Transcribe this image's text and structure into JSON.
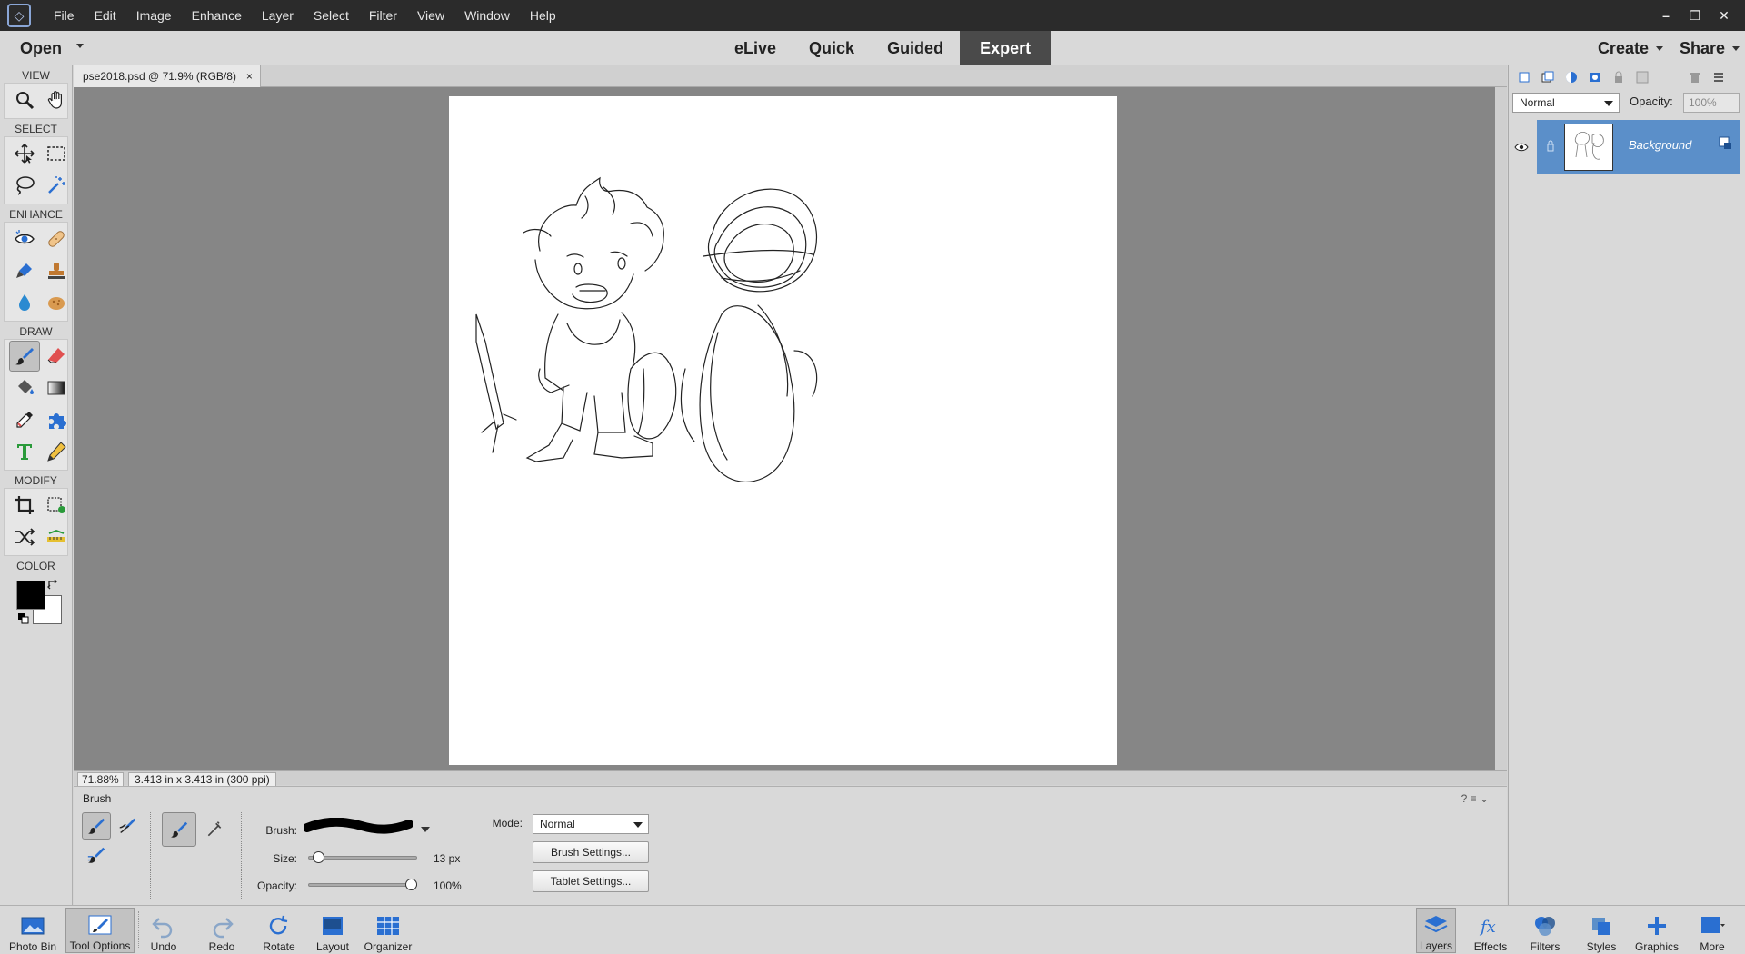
{
  "menubar": {
    "items": [
      "File",
      "Edit",
      "Image",
      "Enhance",
      "Layer",
      "Select",
      "Filter",
      "View",
      "Window",
      "Help"
    ]
  },
  "modebar": {
    "open_label": "Open",
    "tabs": [
      "eLive",
      "Quick",
      "Guided",
      "Expert"
    ],
    "active_tab": "Expert",
    "create_label": "Create",
    "share_label": "Share"
  },
  "toolbox": {
    "sections": {
      "view": "VIEW",
      "select": "SELECT",
      "enhance": "ENHANCE",
      "draw": "DRAW",
      "modify": "MODIFY",
      "color": "COLOR"
    },
    "foreground_color": "#000000",
    "background_color": "#ffffff"
  },
  "document": {
    "tab_title": "pse2018.psd @ 71.9% (RGB/8)",
    "close_label": "×",
    "zoom": "71.88%",
    "doc_size": "3.413 in x 3.413 in (300 ppi)"
  },
  "tool_options": {
    "title": "Brush",
    "brush_label": "Brush:",
    "size_label": "Size:",
    "size_value": "13 px",
    "size_fraction": 0.05,
    "opacity_label": "Opacity:",
    "opacity_value": "100%",
    "opacity_fraction": 1.0,
    "mode_label": "Mode:",
    "mode_value": "Normal",
    "brush_settings_label": "Brush Settings...",
    "tablet_settings_label": "Tablet Settings..."
  },
  "taskbar": {
    "left": [
      "Photo Bin",
      "Tool Options",
      "Undo",
      "Redo",
      "Rotate",
      "Layout",
      "Organizer"
    ],
    "right": [
      "Layers",
      "Effects",
      "Filters",
      "Styles",
      "Graphics",
      "More"
    ]
  },
  "layers_panel": {
    "blend_mode": "Normal",
    "opacity_label": "Opacity:",
    "opacity_value": "100%",
    "layer_name": "Background",
    "accent": "#5b8fc9"
  }
}
